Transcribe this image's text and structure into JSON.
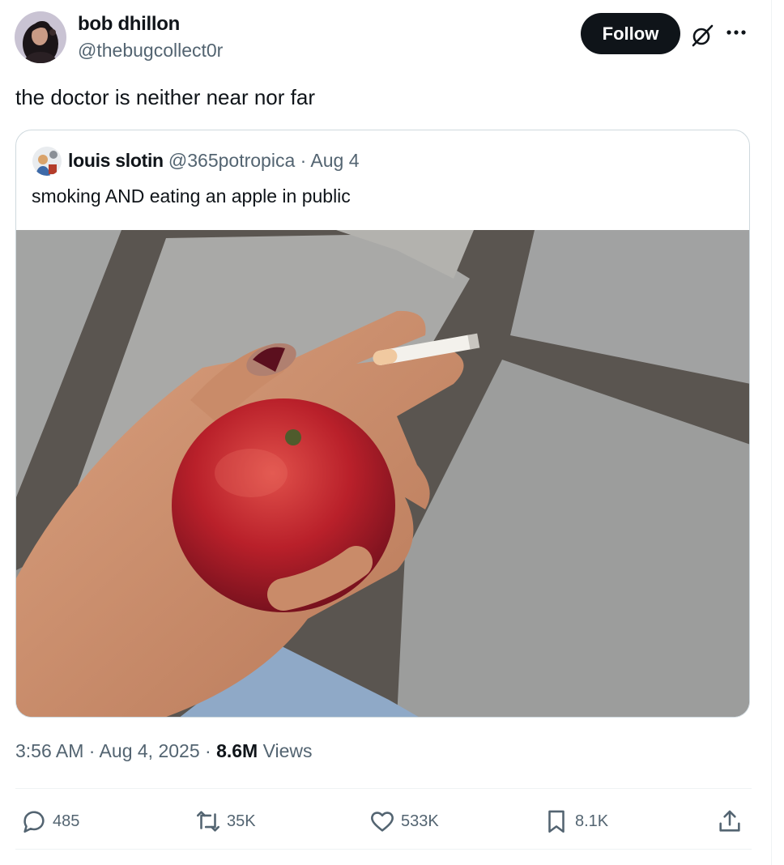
{
  "author": {
    "name": "bob dhillon",
    "handle": "@thebugcollect0r"
  },
  "header": {
    "follow_label": "Follow",
    "grok_icon": "grok-slash-icon",
    "more_icon": "more-dots-icon"
  },
  "tweet": {
    "text": "the doctor is neither near nor far"
  },
  "quote": {
    "name": "louis slotin",
    "handle_date": "@365potropica · Aug 4",
    "text": "smoking AND eating an apple in public"
  },
  "meta": {
    "time_date": "3:56 AM · Aug 4, 2025 · ",
    "views_count": "8.6M",
    "views_label": " Views"
  },
  "actions": {
    "replies": "485",
    "reposts": "35K",
    "likes": "533K",
    "bookmarks": "8.1K"
  },
  "colors": {
    "text_primary": "#0f1419",
    "text_secondary": "#536471",
    "border": "#cfd9de",
    "follow_bg": "#0f1419"
  }
}
